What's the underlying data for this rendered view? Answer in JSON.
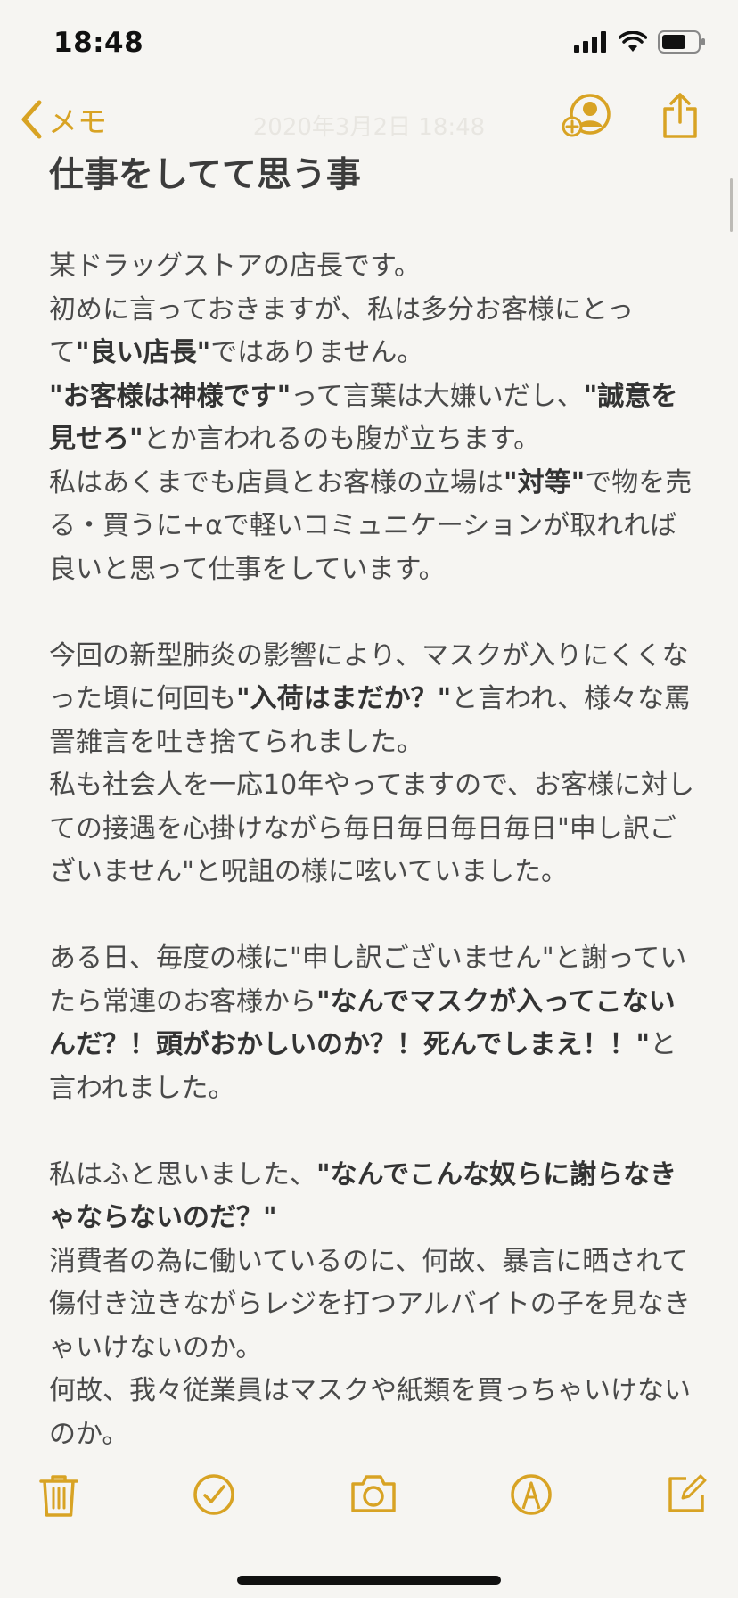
{
  "status_bar": {
    "time": "18:48",
    "icons": [
      "signal-icon",
      "wifi-icon",
      "battery-icon"
    ]
  },
  "nav": {
    "back_label": "メモ",
    "date": "2020年3月2日 18:48",
    "accent": "#d8a324"
  },
  "note": {
    "title": "仕事をしてて思う事",
    "paragraphs": [
      [
        {
          "t": "某ドラッグストアの店長です。",
          "b": false
        }
      ],
      [
        {
          "t": "初めに言っておきますが、私は多分お客様にとって",
          "b": false
        },
        {
          "t": "\"良い店長\"",
          "b": true
        },
        {
          "t": "ではありません。",
          "b": false
        }
      ],
      [
        {
          "t": "\"お客様は神様です\"",
          "b": true
        },
        {
          "t": "って言葉は大嫌いだし、",
          "b": false
        },
        {
          "t": "\"誠意を見せろ\"",
          "b": true
        },
        {
          "t": "とか言われるのも腹が立ちます。",
          "b": false
        }
      ],
      [
        {
          "t": "私はあくまでも店員とお客様の立場は",
          "b": false
        },
        {
          "t": "\"対等\"",
          "b": true
        },
        {
          "t": "で物を売る・買うに+αで軽いコミュニケーションが取れれば良いと思って仕事をしています。",
          "b": false
        }
      ],
      [],
      [
        {
          "t": "今回の新型肺炎の影響により、マスクが入りにくくなった頃に何回も",
          "b": false
        },
        {
          "t": "\"入荷はまだか？\"",
          "b": true
        },
        {
          "t": "と言われ、様々な罵詈雑言を吐き捨てられました。",
          "b": false
        }
      ],
      [
        {
          "t": "私も社会人を一応10年やってますので、お客様に対しての接遇を心掛けながら毎日毎日毎日毎日\"申し訳ございません\"と呪詛の様に呟いていました。",
          "b": false
        }
      ],
      [],
      [
        {
          "t": "ある日、毎度の様に\"申し訳ございません\"と謝っていたら常連のお客様から",
          "b": false
        },
        {
          "t": "\"なんでマスクが入ってこないんだ？！頭がおかしいのか？！死んでしまえ！！\"",
          "b": true
        },
        {
          "t": "と言われました。",
          "b": false
        }
      ],
      [],
      [
        {
          "t": "私はふと思いました、",
          "b": false
        },
        {
          "t": "\"なんでこんな奴らに謝らなきゃならないのだ？\"",
          "b": true
        }
      ],
      [
        {
          "t": "消費者の為に働いているのに、何故、暴言に晒されて傷付き泣きながらレジを打つアルバイトの子を見なきゃいけないのか。",
          "b": false
        }
      ],
      [
        {
          "t": "何故、我々従業員はマスクや紙類を買っちゃいけないのか。",
          "b": false
        }
      ]
    ]
  },
  "toolbar": {
    "icons": [
      "trash-icon",
      "checklist-icon",
      "camera-icon",
      "markup-icon",
      "compose-icon"
    ]
  }
}
